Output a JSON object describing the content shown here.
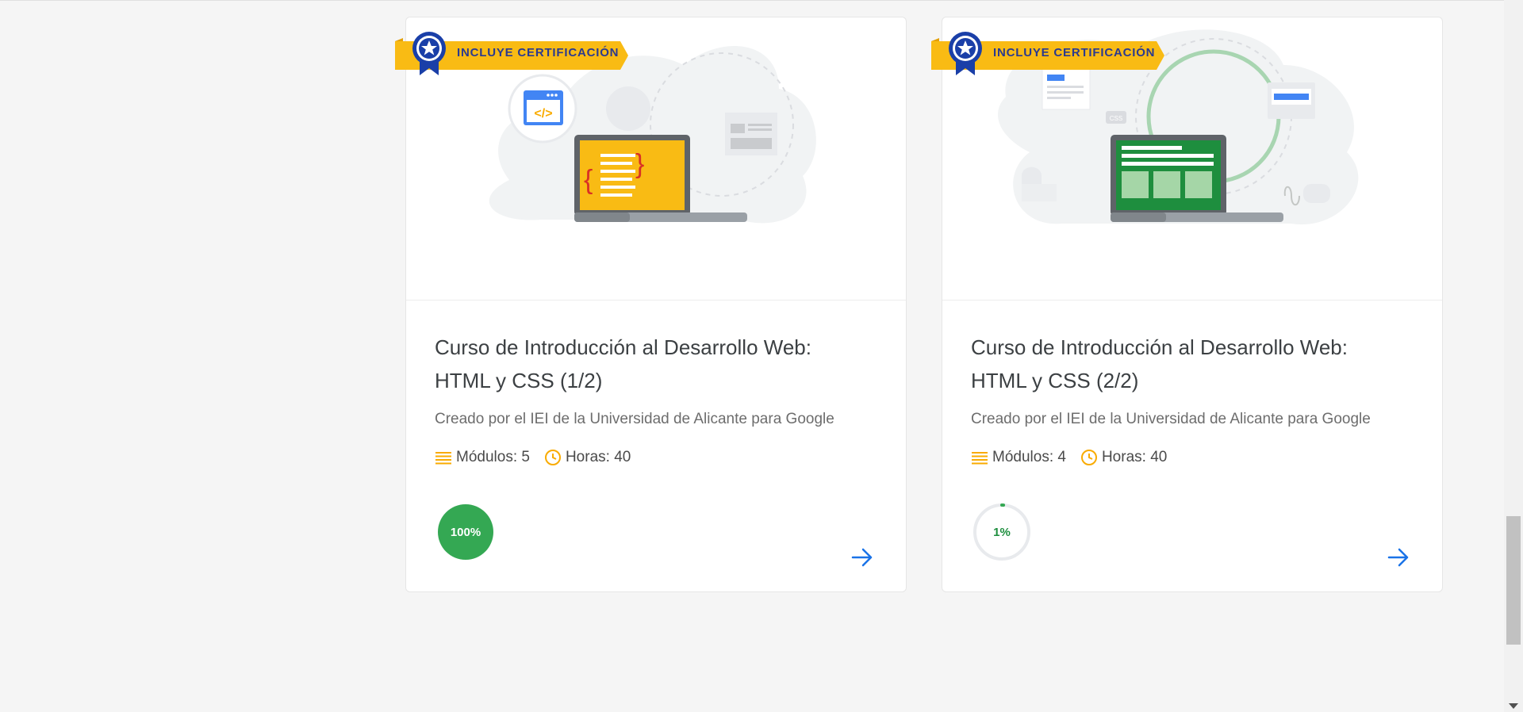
{
  "colors": {
    "accent_green": "#34a853",
    "accent_blue": "#1a73e8",
    "ribbon_yellow": "#f9bb14",
    "badge_text": "#2b3a8f",
    "icon_orange": "#f9ab00"
  },
  "courses": [
    {
      "badge": "INCLUYE CERTIFICACIÓN",
      "title_line1": "Curso de Introducción al Desarrollo Web:",
      "title_line2": "HTML y CSS (1/2)",
      "author": "Creado por el IEI de la Universidad de Alicante para Google",
      "modules": "Módulos: 5",
      "hours": "Horas: 40",
      "progress_label": "100%",
      "progress": 100,
      "icons": {
        "modules": "list-icon",
        "hours": "clock-icon",
        "go": "arrow-right-icon",
        "medal": "star-medal-icon"
      }
    },
    {
      "badge": "INCLUYE CERTIFICACIÓN",
      "title_line1": "Curso de Introducción al Desarrollo Web:",
      "title_line2": "HTML y CSS (2/2)",
      "author": "Creado por el IEI de la Universidad de Alicante para Google",
      "modules": "Módulos: 4",
      "hours": "Horas: 40",
      "progress_label": "1%",
      "progress": 1,
      "icons": {
        "modules": "list-icon",
        "hours": "clock-icon",
        "go": "arrow-right-icon",
        "medal": "star-medal-icon"
      }
    }
  ]
}
